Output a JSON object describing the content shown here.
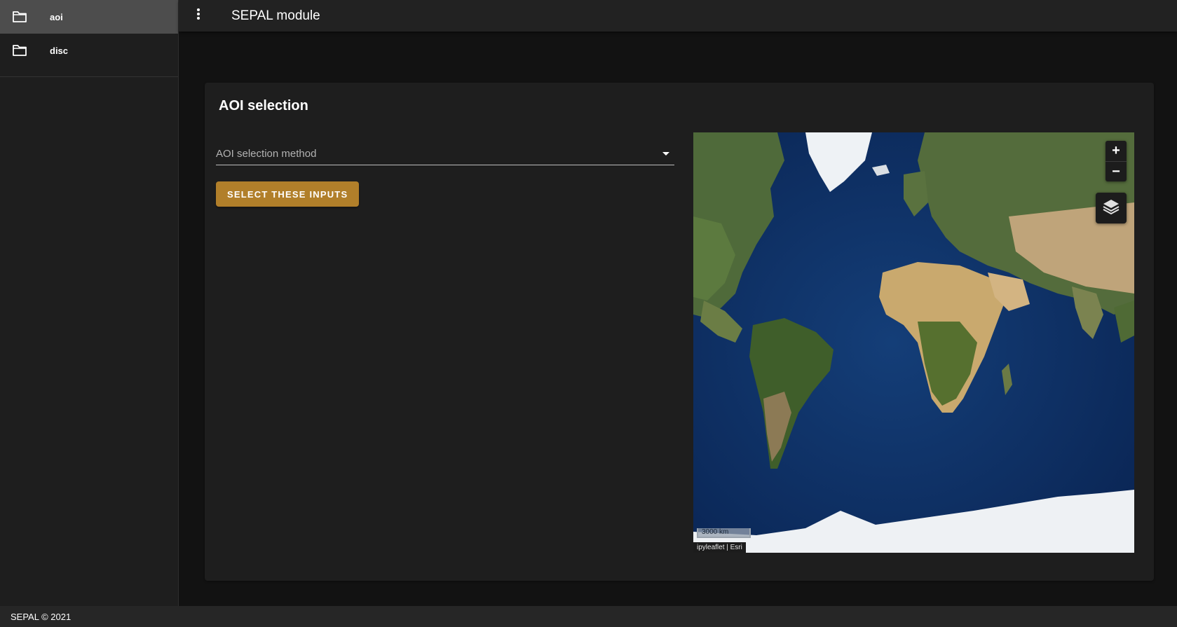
{
  "sidebar": {
    "items": [
      {
        "label": "aoi",
        "icon": "folder-icon",
        "active": true
      },
      {
        "label": "disc",
        "icon": "folder-icon",
        "active": false
      }
    ]
  },
  "appbar": {
    "title": "SEPAL module",
    "menu_icon": "more-vertical-icon"
  },
  "card": {
    "title": "AOI selection",
    "select_placeholder": "AOI selection method",
    "submit_label": "SELECT THESE INPUTS"
  },
  "map": {
    "basemap": "Esri World Imagery",
    "zoom_in_label": "+",
    "zoom_out_label": "−",
    "layers_icon": "layers-icon",
    "scale_label": "3000 km",
    "attribution_lib": "ipyleaflet",
    "attribution_separator": "|",
    "attribution_provider": "Esri"
  },
  "footer": {
    "text": "SEPAL © 2021"
  },
  "colors": {
    "accent": "#b17f2a",
    "background": "#121212",
    "surface": "#1e1e1e",
    "sidebar_active": "#4d4d4d"
  }
}
